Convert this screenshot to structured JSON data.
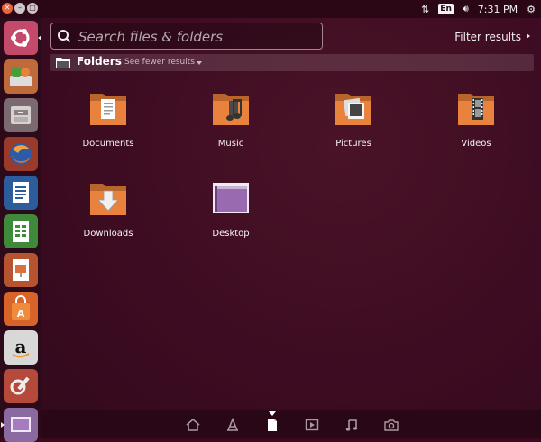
{
  "top_panel": {
    "lang": "En",
    "clock": "7:31 PM"
  },
  "search": {
    "placeholder": "Search files & folders",
    "value": ""
  },
  "filter": {
    "label": "Filter results"
  },
  "category": {
    "title": "Folders",
    "more_label": "See fewer results"
  },
  "folders": [
    {
      "label": "Documents"
    },
    {
      "label": "Music"
    },
    {
      "label": "Pictures"
    },
    {
      "label": "Videos"
    },
    {
      "label": "Downloads"
    },
    {
      "label": "Desktop"
    }
  ],
  "colors": {
    "folder_orange": "#e8823c",
    "dash_bg": "#3d0c22",
    "accent": "#e95420"
  }
}
